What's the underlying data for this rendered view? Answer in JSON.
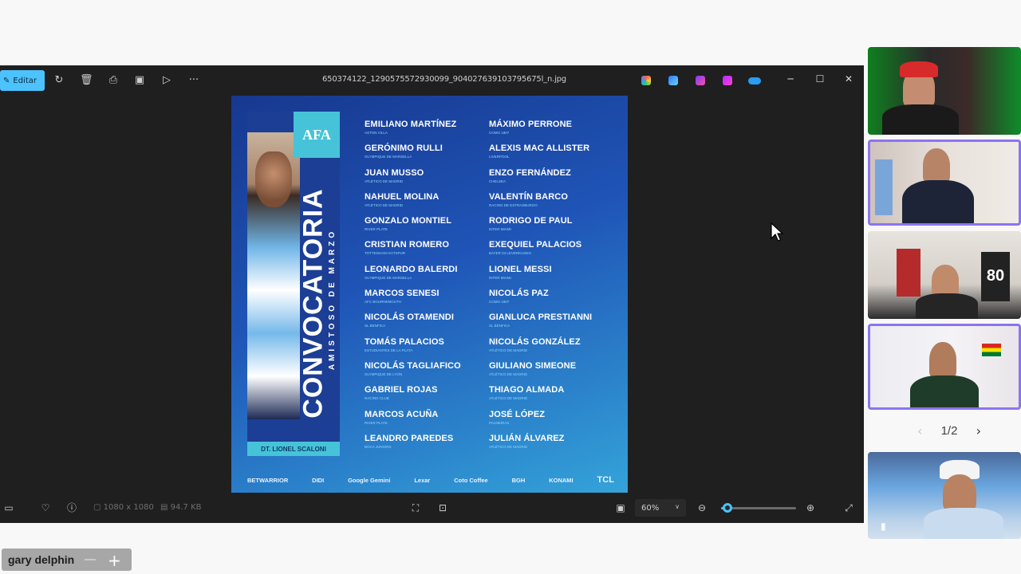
{
  "viewer": {
    "edit_label": "Editar",
    "filename": "650374122_1290575572930099_904027639103795675l_n.jpg",
    "toolbar_icons": [
      "rotate-icon",
      "delete-icon",
      "print-icon",
      "save-icon",
      "slideshow-icon",
      "more-icon"
    ],
    "app_icons": [
      "copilot-icon",
      "designer-icon",
      "clipchamp-icon",
      "apps-icon",
      "onedrive-icon"
    ],
    "status": {
      "dimensions": "1080 x 1080",
      "size": "94.7 KB",
      "zoom": "60%",
      "zoom_level": 0.08
    }
  },
  "poster": {
    "badge": "AFA",
    "title": "CONVOCATORIA",
    "subtitle": "AMISTOSO DE MARZO",
    "coach": "DT. LIONEL SCALONI",
    "column1": [
      {
        "name": "EMILIANO MARTÍNEZ",
        "club": "Aston Villa"
      },
      {
        "name": "GERÓNIMO RULLI",
        "club": "Olympique de Marsella"
      },
      {
        "name": "JUAN MUSSO",
        "club": "Atlético de Madrid"
      },
      {
        "name": "NAHUEL MOLINA",
        "club": "Atlético de Madrid"
      },
      {
        "name": "GONZALO MONTIEL",
        "club": "River Plate"
      },
      {
        "name": "CRISTIAN ROMERO",
        "club": "Tottenham Hotspur"
      },
      {
        "name": "LEONARDO BALERDI",
        "club": "Olympique de Marsella"
      },
      {
        "name": "MARCOS SENESI",
        "club": "AFC Bournemouth"
      },
      {
        "name": "NICOLÁS OTAMENDI",
        "club": "SL Benfica"
      },
      {
        "name": "TOMÁS PALACIOS",
        "club": "Estudiantes de La Plata"
      },
      {
        "name": "NICOLÁS TAGLIAFICO",
        "club": "Olympique de Lyon"
      },
      {
        "name": "GABRIEL ROJAS",
        "club": "Racing Club"
      },
      {
        "name": "MARCOS ACUÑA",
        "club": "River Plate"
      },
      {
        "name": "LEANDRO PAREDES",
        "club": "Boca Juniors"
      }
    ],
    "column2": [
      {
        "name": "MÁXIMO PERRONE",
        "club": "Como 1907"
      },
      {
        "name": "ALEXIS MAC ALLISTER",
        "club": "Liverpool"
      },
      {
        "name": "ENZO FERNÁNDEZ",
        "club": "Chelsea"
      },
      {
        "name": "VALENTÍN BARCO",
        "club": "Racing de Estrasburgo"
      },
      {
        "name": "RODRIGO DE PAUL",
        "club": "Inter Miami"
      },
      {
        "name": "EXEQUIEL PALACIOS",
        "club": "Bayer 04 Leverkusen"
      },
      {
        "name": "LIONEL MESSI",
        "club": "Inter Miami"
      },
      {
        "name": "NICOLÁS PAZ",
        "club": "Como 1907"
      },
      {
        "name": "GIANLUCA PRESTIANNI",
        "club": "SL Benfica"
      },
      {
        "name": "NICOLÁS GONZÁLEZ",
        "club": "Atlético de Madrid"
      },
      {
        "name": "GIULIANO SIMEONE",
        "club": "Atlético de Madrid"
      },
      {
        "name": "THIAGO ALMADA",
        "club": "Atlético de Madrid"
      },
      {
        "name": "JOSÉ LÓPEZ",
        "club": "Palmeiras"
      },
      {
        "name": "JULIÁN ÁLVAREZ",
        "club": "Atlético de Madrid"
      }
    ],
    "sponsors": [
      "BETWARRIOR",
      "DIDI",
      "Google Gemini",
      "Lexar",
      "Coto Coffee",
      "BGH",
      "KONAMI",
      "TCL"
    ]
  },
  "sidebar": {
    "pager": "1/2"
  },
  "nametag": {
    "name": "gary delphin"
  },
  "colors": {
    "accent": "#4cc2ff",
    "active_tile": "#8c74f0",
    "viewer_bg": "#1f1f1f"
  }
}
